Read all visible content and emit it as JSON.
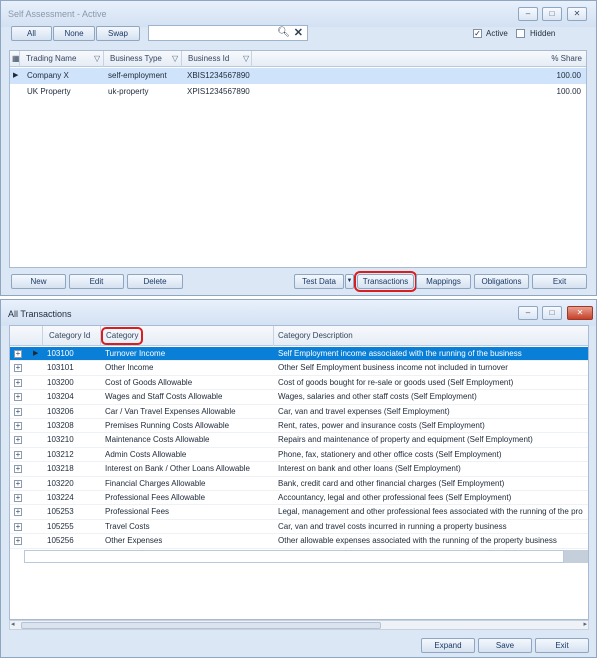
{
  "self_assessment": {
    "title": "Self Assessment - Active",
    "window_controls": [
      "–",
      "□",
      "✕"
    ],
    "filter_buttons": {
      "all": "All",
      "none": "None",
      "swap": "Swap"
    },
    "search": {
      "value": "",
      "placeholder": ""
    },
    "checkboxes": {
      "active": "Active",
      "active_checked": "✓",
      "hidden": "Hidden",
      "hidden_checked": ""
    },
    "columns": [
      "Trading Name",
      "Business Type",
      "Business Id",
      "% Share"
    ],
    "rows": [
      {
        "name": "Company X",
        "type": "self-employment",
        "id": "XBIS1234567890",
        "share": "100.00"
      },
      {
        "name": "UK Property",
        "type": "uk-property",
        "id": "XPIS1234567890",
        "share": "100.00"
      }
    ],
    "buttons": {
      "new": "New",
      "edit": "Edit",
      "delete": "Delete",
      "test_data": "Test Data",
      "transactions": "Transactions",
      "mappings": "Mappings",
      "obligations": "Obligations",
      "exit": "Exit"
    }
  },
  "all_transactions": {
    "title": "All Transactions",
    "window_controls": [
      "–",
      "□",
      "✕"
    ],
    "columns": [
      "Category Id",
      "Category",
      "Category Description"
    ],
    "rows": [
      {
        "id": "103100",
        "category": "Turnover Income",
        "desc": "Self Employment income associated with the running of the business"
      },
      {
        "id": "103101",
        "category": "Other Income",
        "desc": "Other Self Employment business income not included in turnover"
      },
      {
        "id": "103200",
        "category": "Cost of Goods Allowable",
        "desc": "Cost of goods bought for re-sale or goods used (Self Employment)"
      },
      {
        "id": "103204",
        "category": "Wages and Staff Costs Allowable",
        "desc": "Wages, salaries and other staff costs (Self Employment)"
      },
      {
        "id": "103206",
        "category": "Car / Van Travel Expenses Allowable",
        "desc": "Car, van and travel expenses (Self Employment)"
      },
      {
        "id": "103208",
        "category": "Premises Running Costs Allowable",
        "desc": "Rent, rates, power and insurance costs (Self Employment)"
      },
      {
        "id": "103210",
        "category": "Maintenance Costs Allowable",
        "desc": "Repairs and maintenance of property and equipment (Self Employment)"
      },
      {
        "id": "103212",
        "category": "Admin Costs Allowable",
        "desc": "Phone, fax, stationery and other office costs (Self Employment)"
      },
      {
        "id": "103218",
        "category": "Interest on Bank / Other Loans Allowable",
        "desc": "Interest on bank and other loans (Self Employment)"
      },
      {
        "id": "103220",
        "category": "Financial Charges Allowable",
        "desc": "Bank, credit card and other financial charges (Self Employment)"
      },
      {
        "id": "103224",
        "category": "Professional Fees Allowable",
        "desc": "Accountancy, legal and other professional fees (Self Employment)"
      },
      {
        "id": "105253",
        "category": "Professional Fees",
        "desc": "Legal, management and other professional fees associated with the running of the pro"
      },
      {
        "id": "105255",
        "category": "Travel Costs",
        "desc": "Car, van and travel costs incurred in running a property business"
      },
      {
        "id": "105256",
        "category": "Other Expenses",
        "desc": "Other allowable expenses associated with the running of the property business"
      }
    ],
    "buttons": {
      "expand": "Expand",
      "save": "Save",
      "exit": "Exit"
    }
  }
}
